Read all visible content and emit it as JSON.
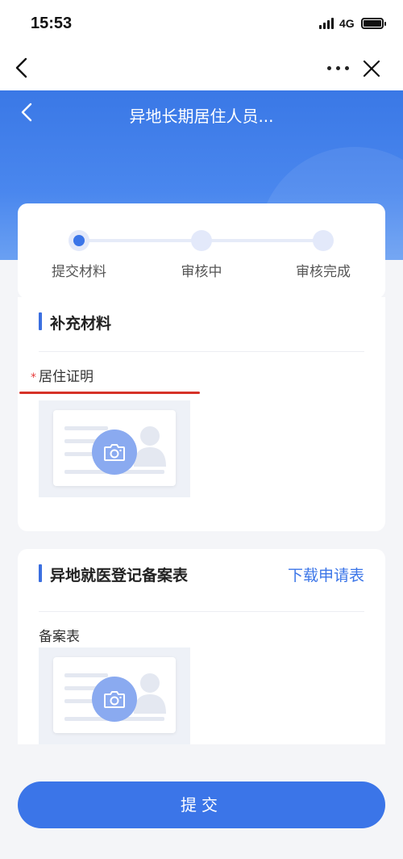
{
  "status_bar": {
    "time": "15:53",
    "network": "4G"
  },
  "hero": {
    "title": "异地长期居住人员..."
  },
  "steps": [
    {
      "label": "提交材料",
      "active": true
    },
    {
      "label": "审核中",
      "active": false
    },
    {
      "label": "审核完成",
      "active": false
    }
  ],
  "material_section": {
    "title": "补充材料",
    "field_label": "居住证明",
    "required_mark": "*"
  },
  "form_section": {
    "title": "异地就医登记备案表",
    "download_label": "下载申请表",
    "field_label": "备案表"
  },
  "submit_label": "提交",
  "colors": {
    "accent": "#3b75e8",
    "required": "#e63b3b"
  }
}
